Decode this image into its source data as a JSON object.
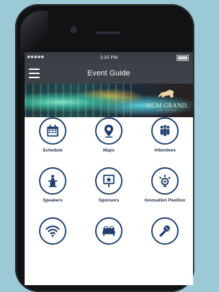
{
  "status_bar": {
    "time": "3:33 PM"
  },
  "header": {
    "title": "Event Guide"
  },
  "banner": {
    "brand_name": "MGM GRAND.",
    "brand_sub": "LAS VEGAS"
  },
  "colors": {
    "icon_ring": "#1f3f6e",
    "navbar": "#3f4149",
    "background": "#9cc9d6"
  },
  "menu": {
    "items": [
      {
        "label": "Schedule",
        "icon": "calendar-icon"
      },
      {
        "label": "Maps",
        "icon": "map-pin-icon"
      },
      {
        "label": "Attendees",
        "icon": "people-icon"
      },
      {
        "label": "Speakers",
        "icon": "podium-icon"
      },
      {
        "label": "Sponsors",
        "icon": "sign-star-icon"
      },
      {
        "label": "Innovation Pavilion",
        "icon": "lightbulb-icon"
      },
      {
        "label": "",
        "icon": "wifi-icon"
      },
      {
        "label": "",
        "icon": "bed-icon"
      },
      {
        "label": "",
        "icon": "microphone-icon"
      }
    ]
  }
}
